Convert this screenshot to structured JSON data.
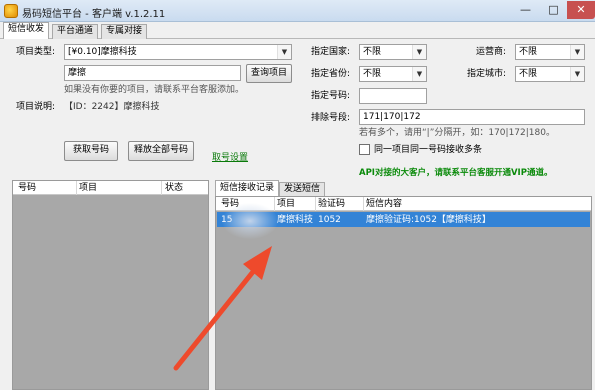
{
  "window": {
    "title": "易码短信平台 - 客户端 v.1.2.11",
    "minimize": "—",
    "maximize": "□",
    "close": "✕"
  },
  "tabs": [
    "短信收发",
    "平台通道",
    "专属对接"
  ],
  "form": {
    "project_type_label": "项目类型:",
    "project_type_value": "[¥0.10]摩擦科技",
    "search_value": "摩擦",
    "query_button": "查询项目",
    "hint": "如果没有你要的项目，请联系平台客服添加。",
    "desc_label": "项目说明:",
    "desc_value": "【ID：2242】摩擦科技",
    "get_number_button": "获取号码",
    "release_all_button": "释放全部号码",
    "number_settings_link": "取号设置"
  },
  "filters": {
    "country_label": "指定国家:",
    "country_value": "不限",
    "operator_label": "运营商:",
    "operator_value": "不限",
    "province_label": "指定省份:",
    "province_value": "不限",
    "city_label": "指定城市:",
    "city_value": "不限",
    "number_label": "指定号码:",
    "number_value": "",
    "exclude_label": "排除号段:",
    "exclude_value": "171|170|172",
    "exclude_hint": "若有多个，请用“|”分隔开，如：170|172|180。",
    "same_project_label": "同一项目同一号码接收多条",
    "promo": "API对接的大客户，请联系平台客服开通VIP通道。"
  },
  "number_list": {
    "columns": [
      "号码",
      "项目",
      "状态"
    ]
  },
  "sms_tabs": [
    "短信接收记录",
    "发送短信"
  ],
  "sms_table": {
    "columns": [
      "号码",
      "项目",
      "验证码",
      "短信内容"
    ],
    "rows": [
      {
        "number": "15",
        "project": "摩擦科技",
        "code": "1052",
        "content": "摩擦验证码:1052【摩擦科技】"
      }
    ]
  }
}
